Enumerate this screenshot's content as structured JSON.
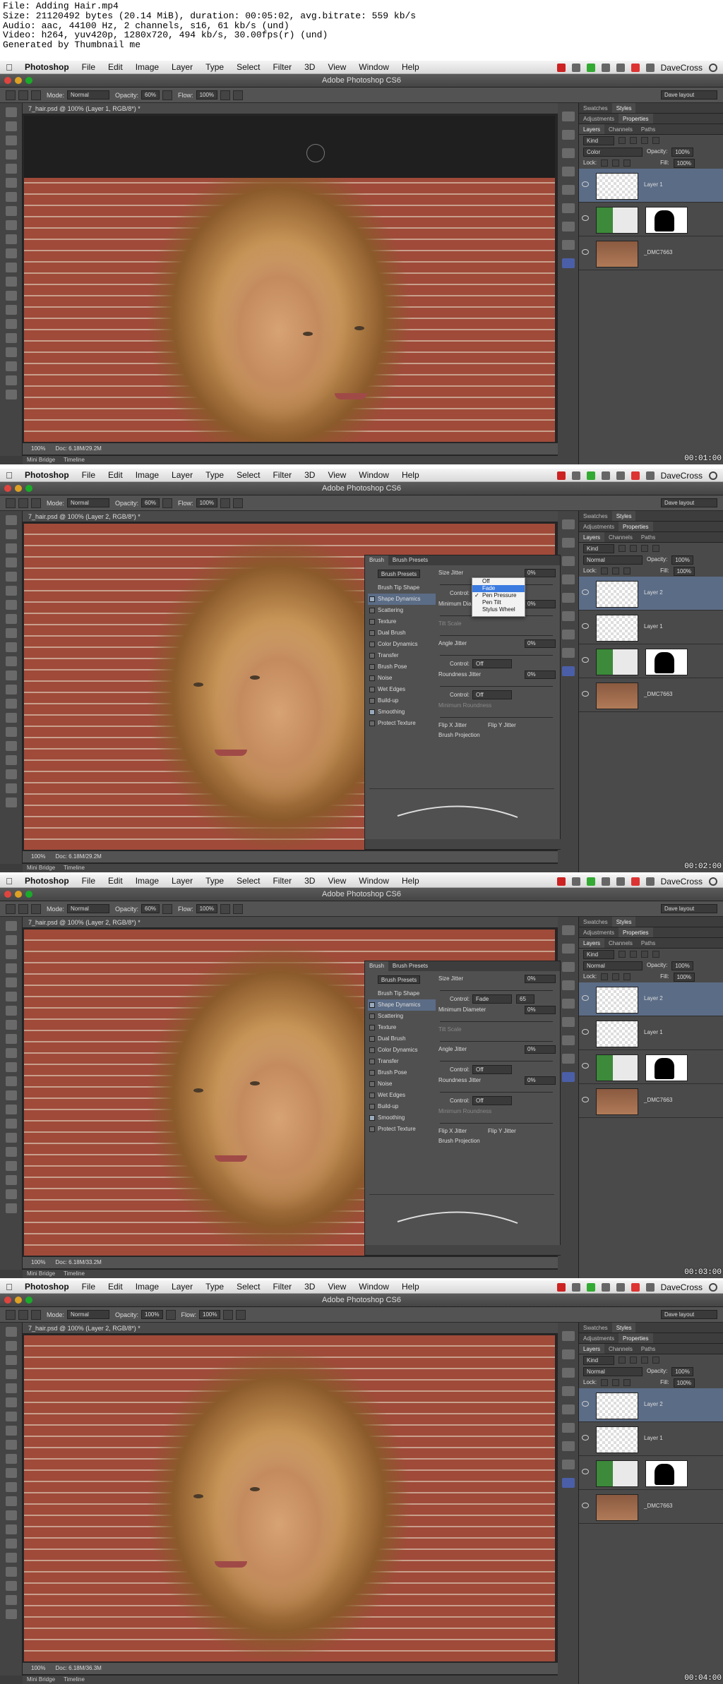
{
  "header": {
    "lines": [
      "File: Adding Hair.mp4",
      "Size: 21120492 bytes (20.14 MiB), duration: 00:05:02, avg.bitrate: 559 kb/s",
      "Audio: aac, 44100 Hz, 2 channels, s16, 61 kb/s (und)",
      "Video: h264, yuv420p, 1280x720, 494 kb/s, 30.00fps(r) (und)",
      "Generated by Thumbnail me"
    ]
  },
  "menubar": {
    "apple": "",
    "app": "Photoshop",
    "items": [
      "File",
      "Edit",
      "Image",
      "Layer",
      "Type",
      "Select",
      "Filter",
      "3D",
      "View",
      "Window",
      "Help"
    ],
    "user": "DaveCross"
  },
  "window_title": "Adobe Photoshop CS6",
  "options": {
    "mode_label": "Mode:",
    "mode_value": "Normal",
    "opacity_label": "Opacity:",
    "flow_label": "Flow:",
    "flow_value": "100%",
    "workspace": "Dave layout"
  },
  "frames": [
    {
      "tab": "7_hair.psd @ 100% (Layer 1, RGB/8*) *",
      "opacity": "60%",
      "zoom": "100%",
      "doc": "Doc: 6.18M/29.2M",
      "timestamp": "00:01:00",
      "blend": "Color",
      "layer_opacity": "100%",
      "fill": "100%",
      "layers": [
        "Layer 1",
        "",
        "_DMC7663"
      ]
    },
    {
      "tab": "7_hair.psd @ 100% (Layer 2, RGB/8*) *",
      "opacity": "60%",
      "zoom": "100%",
      "doc": "Doc: 6.18M/29.2M",
      "timestamp": "00:02:00",
      "blend": "Normal",
      "layer_opacity": "100%",
      "fill": "100%",
      "layers": [
        "Layer 2",
        "Layer 1",
        "",
        "_DMC7663"
      ]
    },
    {
      "tab": "7_hair.psd @ 100% (Layer 2, RGB/8*) *",
      "opacity": "60%",
      "zoom": "100%",
      "doc": "Doc: 6.18M/33.2M",
      "timestamp": "00:03:00",
      "blend": "Normal",
      "layer_opacity": "100%",
      "fill": "100%",
      "layers": [
        "Layer 2",
        "Layer 1",
        "",
        "_DMC7663"
      ]
    },
    {
      "tab": "7_hair.psd @ 100% (Layer 2, RGB/8*) *",
      "opacity": "100%",
      "zoom": "100%",
      "doc": "Doc: 6.18M/36.3M",
      "timestamp": "00:04:00",
      "blend": "Normal",
      "layer_opacity": "100%",
      "fill": "100%",
      "layers": [
        "Layer 2",
        "Layer 1",
        "",
        "_DMC7663"
      ]
    }
  ],
  "panel_tabs": {
    "swatches": "Swatches",
    "styles": "Styles",
    "adjustments": "Adjustments",
    "properties": "Properties",
    "layers": "Layers",
    "channels": "Channels",
    "paths": "Paths",
    "kind": "Kind",
    "opacity_label": "Opacity:",
    "fill_label": "Fill:",
    "lock_label": "Lock:"
  },
  "bottom_tabs": [
    "Mini Bridge",
    "Timeline"
  ],
  "brush_panel": {
    "tabs": [
      "Brush",
      "Brush Presets"
    ],
    "preset_button": "Brush Presets",
    "items": [
      "Brush Tip Shape",
      "Shape Dynamics",
      "Scattering",
      "Texture",
      "Dual Brush",
      "Color Dynamics",
      "Transfer",
      "Brush Pose",
      "Noise",
      "Wet Edges",
      "Build-up",
      "Smoothing",
      "Protect Texture"
    ],
    "size_jitter": "Size Jitter",
    "size_jitter_value": "0%",
    "control_label": "Control:",
    "fade_value": "Fade",
    "fade_steps": "65",
    "min_diameter": "Minimum Diameter",
    "min_diameter_value": "0%",
    "tilt_scale": "Tilt Scale",
    "angle_jitter": "Angle Jitter",
    "angle_jitter_value": "0%",
    "off": "Off",
    "roundness_jitter": "Roundness Jitter",
    "roundness_jitter_value": "0%",
    "min_roundness": "Minimum Roundness",
    "flip_x": "Flip X Jitter",
    "flip_y": "Flip Y Jitter",
    "brush_projection": "Brush Projection"
  },
  "dropdown": {
    "items": [
      "Off",
      "Fade",
      "Pen Pressure",
      "Pen Tilt",
      "Stylus Wheel"
    ]
  }
}
